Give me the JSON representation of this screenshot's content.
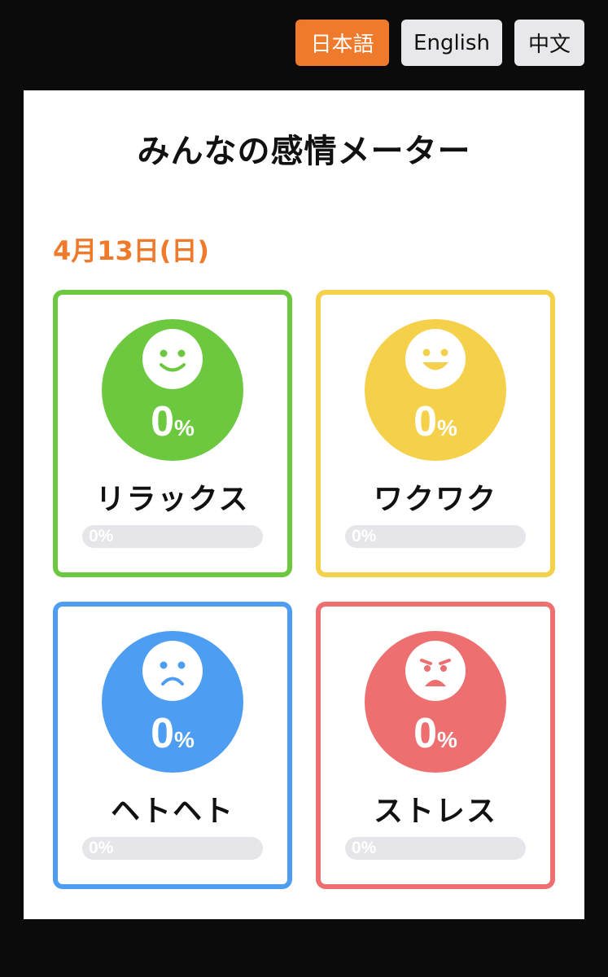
{
  "languages": [
    {
      "label": "日本語",
      "active": true
    },
    {
      "label": "English",
      "active": false
    },
    {
      "label": "中文",
      "active": false
    }
  ],
  "title": "みんなの感情メーター",
  "date": "4月13日(日)",
  "emotions": [
    {
      "label": "リラックス",
      "percent": "0",
      "unit": "%",
      "bar_text": "0%",
      "level": 0,
      "color": "#6cc93f",
      "face": "smile-face-icon"
    },
    {
      "label": "ワクワク",
      "percent": "0",
      "unit": "%",
      "bar_text": "0%",
      "level": 0,
      "color": "#f5d04a",
      "face": "grin-face-icon"
    },
    {
      "label": "ヘトヘト",
      "percent": "0",
      "unit": "%",
      "bar_text": "0%",
      "level": 0,
      "color": "#4d9ef2",
      "face": "sad-face-icon"
    },
    {
      "label": "ストレス",
      "percent": "0",
      "unit": "%",
      "bar_text": "0%",
      "level": 0,
      "color": "#ee6f6f",
      "face": "stressed-face-icon"
    }
  ]
}
